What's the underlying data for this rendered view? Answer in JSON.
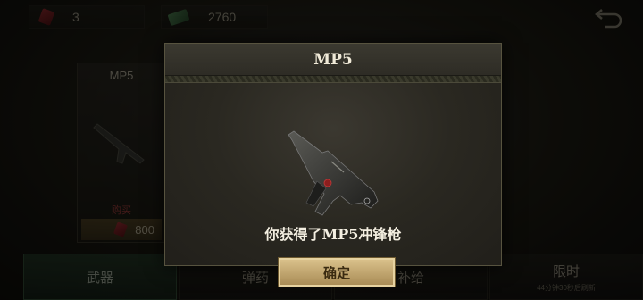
{
  "topbar": {
    "gems": "3",
    "cash": "2760"
  },
  "shop": {
    "card_title": "MP5",
    "card_buy_label": "购买",
    "card_price": "800"
  },
  "tabs": [
    {
      "label": "武器",
      "sub": ""
    },
    {
      "label": "弹药",
      "sub": ""
    },
    {
      "label": "补给",
      "sub": ""
    },
    {
      "label": "限时",
      "sub": "44分钟30秒后刷新"
    }
  ],
  "dialog": {
    "title": "MP5",
    "message": "你获得了MP5冲锋枪",
    "confirm_label": "确定"
  },
  "colors": {
    "gem": "#c0303a",
    "cash": "#5fa86a",
    "button": "#d9c08a",
    "active_tab": "#26402d"
  }
}
